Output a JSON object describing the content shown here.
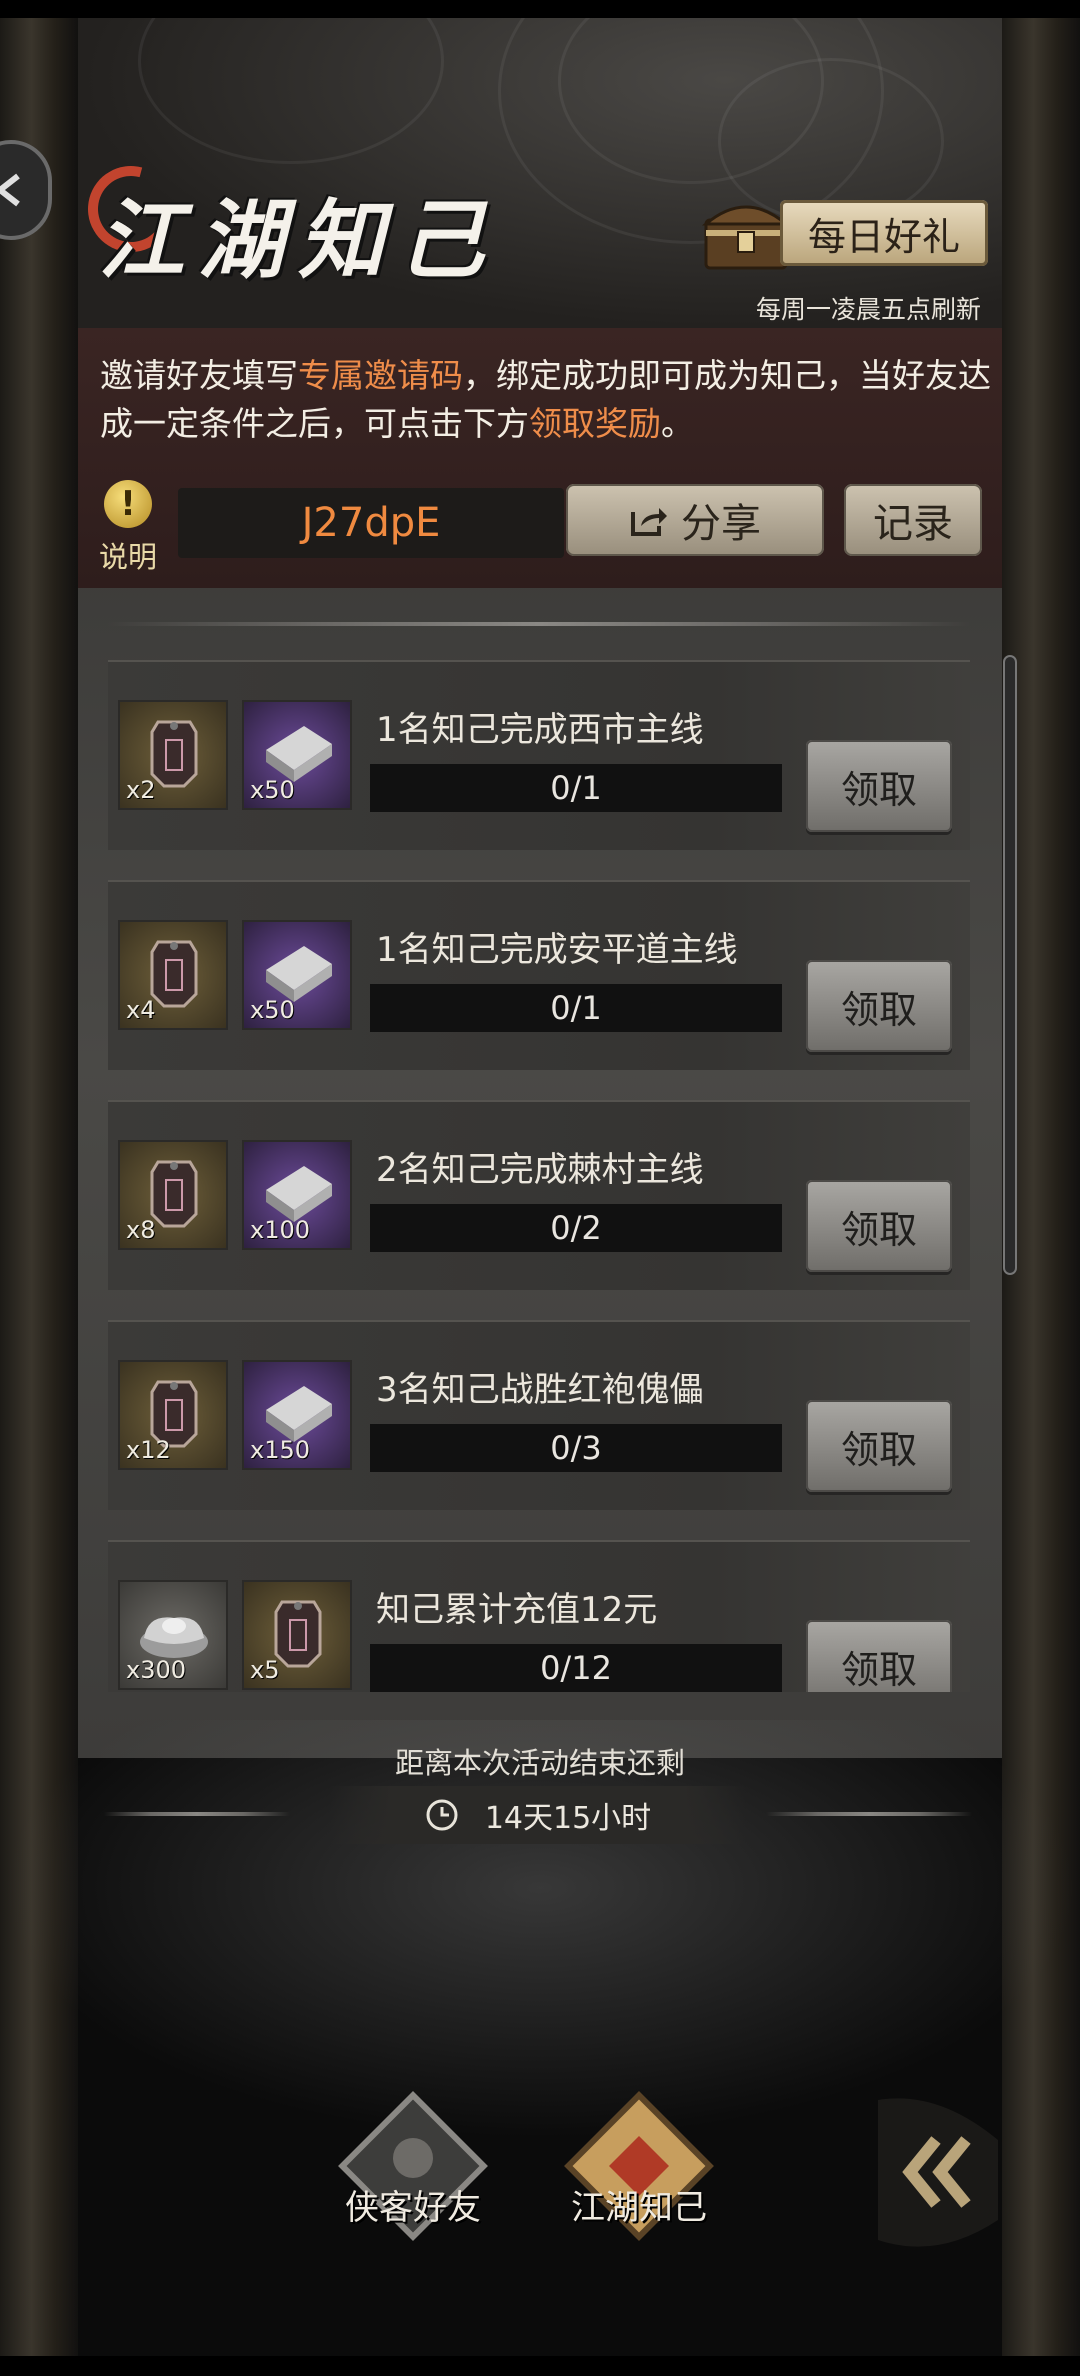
{
  "header": {
    "title": "江湖知己",
    "daily_gift_label": "每日好礼",
    "daily_refresh_note": "每周一凌晨五点刷新"
  },
  "invite": {
    "text_part1": "邀请好友填写",
    "text_highlight1": "专属邀请码",
    "text_part2": "，绑定成功即可成为知己，当好友达成一定条件之后，可点击下方",
    "text_highlight2": "领取奖励",
    "text_part3": "。",
    "help_label": "说明",
    "help_icon": "!",
    "code": "J27dpE",
    "share_label": "分享",
    "record_label": "记录"
  },
  "tasks": [
    {
      "name": "1名知己完成西市主线",
      "progress": "0/1",
      "claim_label": "领取",
      "rewards": [
        {
          "icon": "token-icon",
          "count": "x2",
          "bg": "gold"
        },
        {
          "icon": "silver-bar-icon",
          "count": "x50",
          "bg": "purple"
        }
      ]
    },
    {
      "name": "1名知己完成安平道主线",
      "progress": "0/1",
      "claim_label": "领取",
      "rewards": [
        {
          "icon": "token-icon",
          "count": "x4",
          "bg": "gold"
        },
        {
          "icon": "silver-bar-icon",
          "count": "x50",
          "bg": "purple"
        }
      ]
    },
    {
      "name": "2名知己完成棘村主线",
      "progress": "0/2",
      "claim_label": "领取",
      "rewards": [
        {
          "icon": "token-icon",
          "count": "x8",
          "bg": "gold"
        },
        {
          "icon": "silver-bar-icon",
          "count": "x100",
          "bg": "purple"
        }
      ]
    },
    {
      "name": "3名知己战胜红袍傀儡",
      "progress": "0/3",
      "claim_label": "领取",
      "rewards": [
        {
          "icon": "token-icon",
          "count": "x12",
          "bg": "gold"
        },
        {
          "icon": "silver-bar-icon",
          "count": "x150",
          "bg": "purple"
        }
      ]
    },
    {
      "name": "知己累计充值12元",
      "progress": "0/12",
      "claim_label": "领取",
      "rewards": [
        {
          "icon": "silver-ingot-icon",
          "count": "x300",
          "bg": "gray"
        },
        {
          "icon": "token-icon",
          "count": "x5",
          "bg": "gold"
        }
      ]
    }
  ],
  "countdown": {
    "label": "距离本次活动结束还剩",
    "time": "14天15小时"
  },
  "nav": {
    "tab1_label": "侠客好友",
    "tab2_label": "江湖知己"
  },
  "colors": {
    "highlight": "#ef8d4a",
    "code": "#f08a40",
    "title_accent": "#c2442e"
  }
}
